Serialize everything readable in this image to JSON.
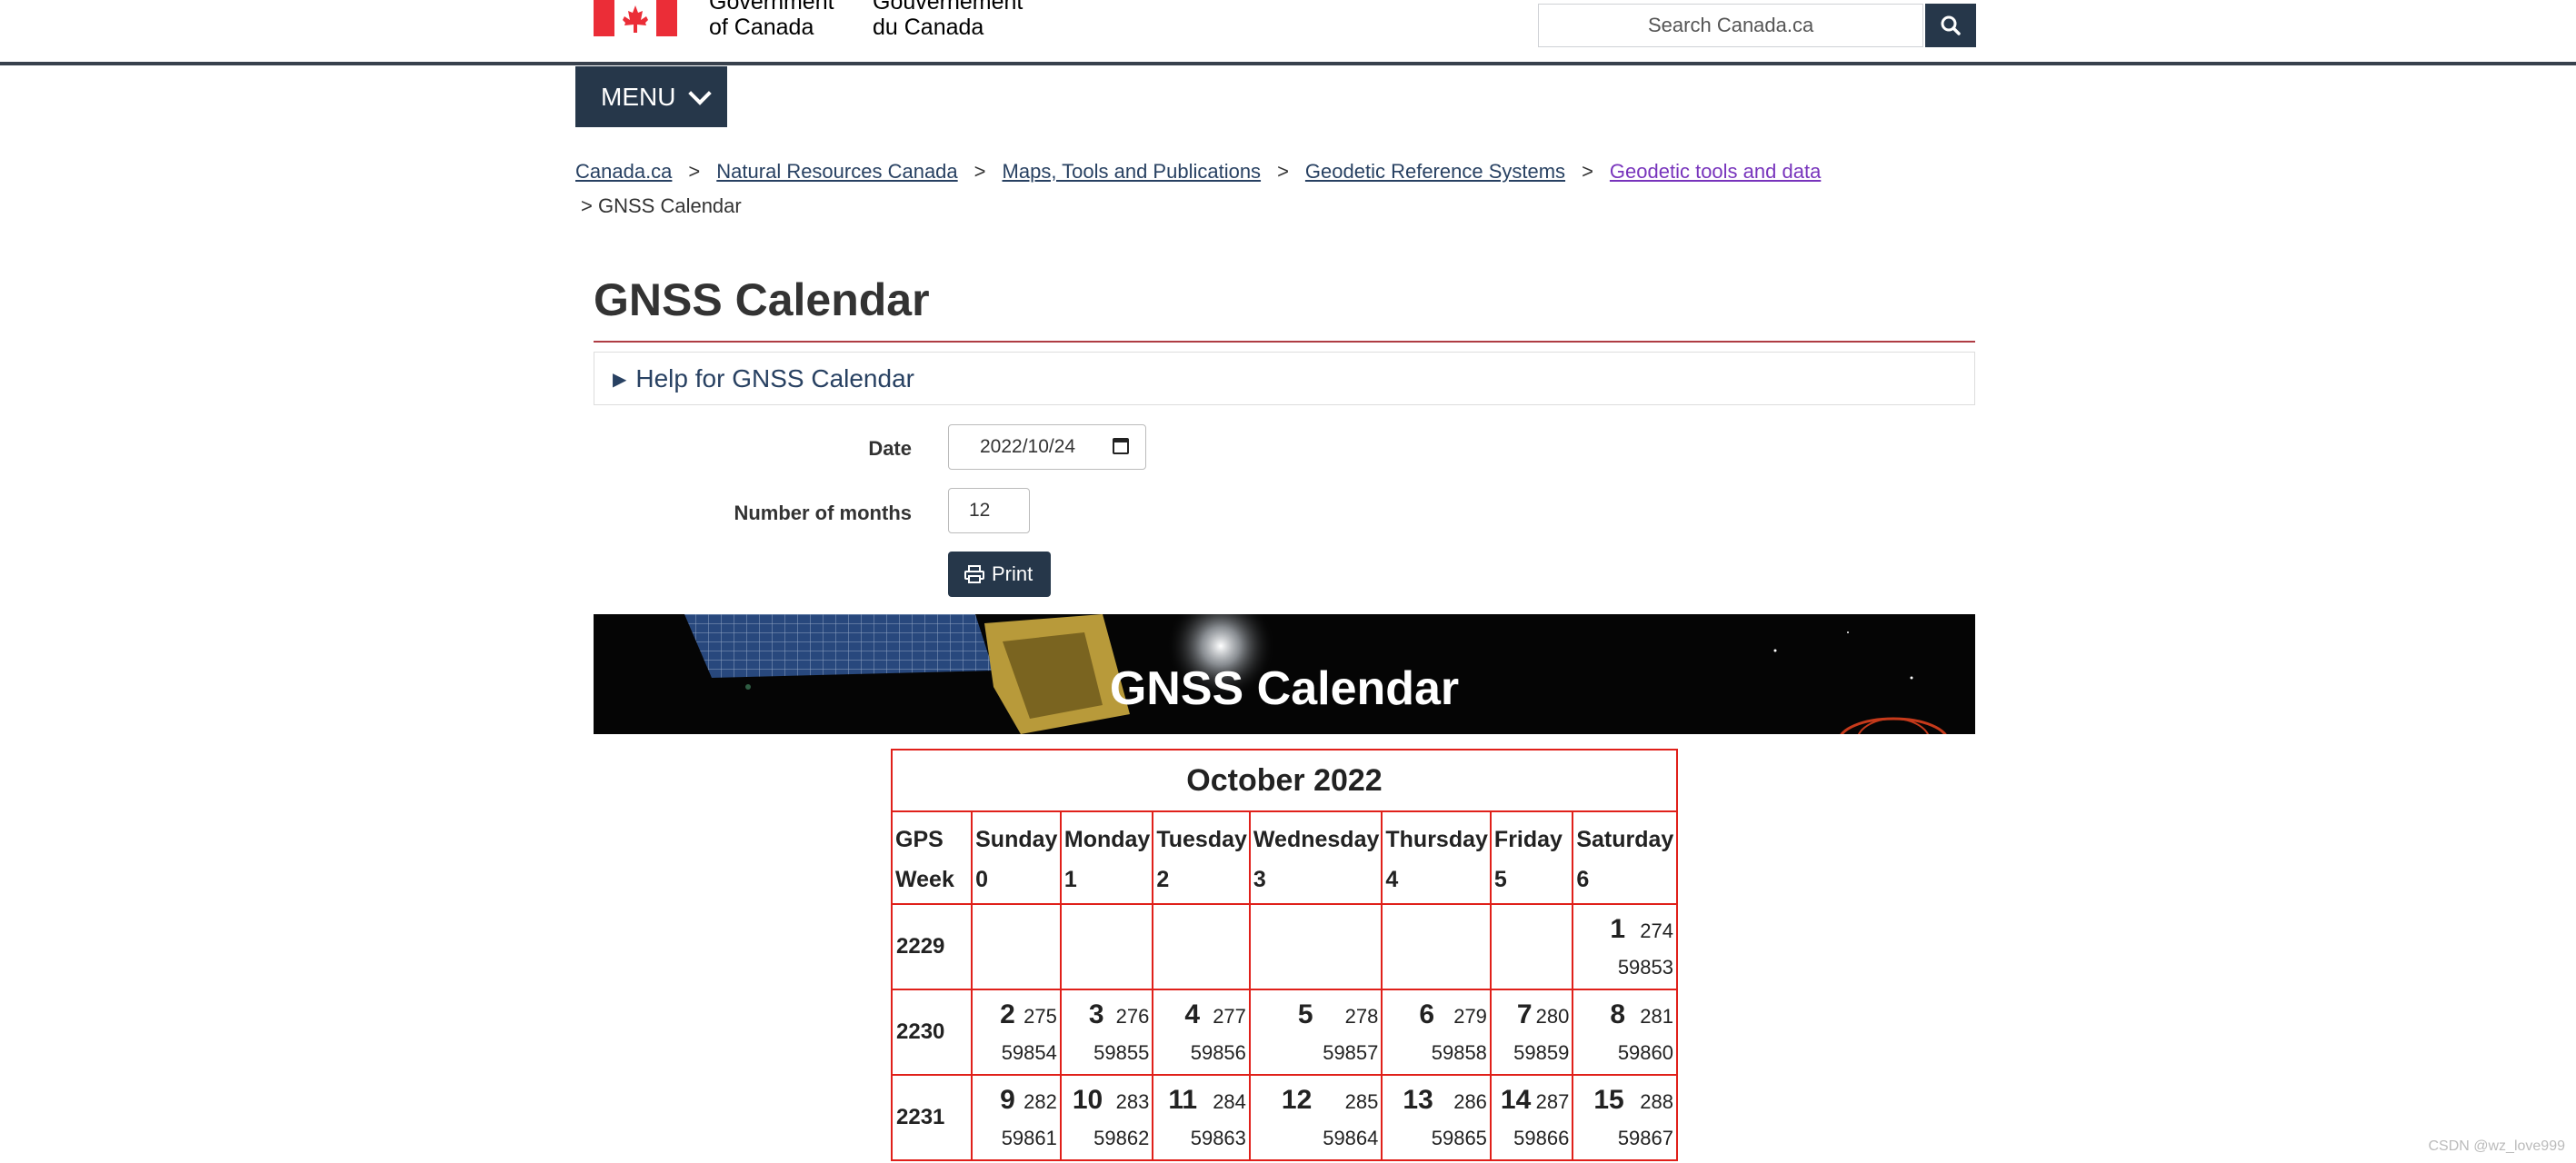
{
  "header": {
    "wordmark_en_line1": "Government",
    "wordmark_en_line2": "of Canada",
    "wordmark_fr_line1": "Gouvernement",
    "wordmark_fr_line2": "du Canada",
    "search_placeholder": "Search Canada.ca",
    "brand_color": "#26374a",
    "flag_color": "#eb2d37"
  },
  "menu": {
    "label": "MENU"
  },
  "breadcrumb": {
    "items": [
      "Canada.ca",
      "Natural Resources Canada",
      "Maps, Tools and Publications",
      "Geodetic Reference Systems",
      "Geodetic tools and data"
    ],
    "current": "GNSS Calendar",
    "separator": ">"
  },
  "page": {
    "title": "GNSS Calendar",
    "help_summary": "Help for GNSS Calendar"
  },
  "form": {
    "date_label": "Date",
    "date_value": "2022/10/24",
    "months_label": "Number of months",
    "months_value": "12",
    "print_label": "Print"
  },
  "banner": {
    "title": "GNSS Calendar"
  },
  "calendar": {
    "month_title": "October 2022",
    "gps_week_label_1": "GPS",
    "gps_week_label_2": "Week",
    "days": [
      {
        "name": "Sunday",
        "index": "0"
      },
      {
        "name": "Monday",
        "index": "1"
      },
      {
        "name": "Tuesday",
        "index": "2"
      },
      {
        "name": "Wednesday",
        "index": "3"
      },
      {
        "name": "Thursday",
        "index": "4"
      },
      {
        "name": "Friday",
        "index": "5"
      },
      {
        "name": "Saturday",
        "index": "6"
      }
    ],
    "weeks": [
      {
        "gps_week": "2229",
        "cells": [
          null,
          null,
          null,
          null,
          null,
          null,
          {
            "day": "1",
            "doy": "274",
            "mjd": "59853"
          }
        ]
      },
      {
        "gps_week": "2230",
        "cells": [
          {
            "day": "2",
            "doy": "275",
            "mjd": "59854"
          },
          {
            "day": "3",
            "doy": "276",
            "mjd": "59855"
          },
          {
            "day": "4",
            "doy": "277",
            "mjd": "59856"
          },
          {
            "day": "5",
            "doy": "278",
            "mjd": "59857"
          },
          {
            "day": "6",
            "doy": "279",
            "mjd": "59858"
          },
          {
            "day": "7",
            "doy": "280",
            "mjd": "59859"
          },
          {
            "day": "8",
            "doy": "281",
            "mjd": "59860"
          }
        ]
      },
      {
        "gps_week": "2231",
        "cells": [
          {
            "day": "9",
            "doy": "282",
            "mjd": "59861"
          },
          {
            "day": "10",
            "doy": "283",
            "mjd": "59862"
          },
          {
            "day": "11",
            "doy": "284",
            "mjd": "59863"
          },
          {
            "day": "12",
            "doy": "285",
            "mjd": "59864"
          },
          {
            "day": "13",
            "doy": "286",
            "mjd": "59865"
          },
          {
            "day": "14",
            "doy": "287",
            "mjd": "59866"
          },
          {
            "day": "15",
            "doy": "288",
            "mjd": "59867"
          }
        ]
      }
    ],
    "border_color": "#e0201a"
  },
  "watermark": "CSDN @wz_love999"
}
